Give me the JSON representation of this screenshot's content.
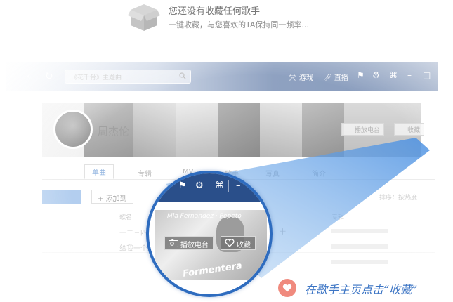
{
  "empty_state": {
    "icon": "open-box-icon",
    "title": "您还没有收藏任何歌手",
    "subtitle": "一键收藏，与您喜欢的TA保持同一频率..."
  },
  "app": {
    "search": {
      "placeholder": "《花千骨》主题曲"
    },
    "header": {
      "game_label": "游戏",
      "live_label": "直播",
      "icons": [
        "shirt-icon",
        "gear-icon",
        "minimize-mode-icon",
        "minimize-icon",
        "close-icon"
      ]
    },
    "artist": {
      "name": "周杰伦",
      "radio_label": "播放电台",
      "fav_label": "收藏"
    },
    "tabs": [
      {
        "label": "单曲"
      },
      {
        "label": "专辑"
      },
      {
        "label": "MV"
      },
      {
        "label": "歌手"
      },
      {
        "label": "写真"
      },
      {
        "label": "简介"
      }
    ],
    "toolbar": {
      "add_to_label": "添加到",
      "sort_label": "排序：按热度"
    },
    "columns": {
      "song": "歌名",
      "album": "专辑"
    },
    "songs": [
      {
        "title": "一二三四五"
      },
      {
        "title": "给我一个理由"
      },
      {
        "title": ""
      }
    ],
    "song_mark": "十"
  },
  "magnifier": {
    "radio_label": "播放电台",
    "fav_label": "收藏",
    "album_logo": "Mia Fernandez · Pepeto",
    "album_word": "Formentera"
  },
  "hint": {
    "text": "在歌手主页点击“收藏”",
    "color": "#3b74c4",
    "badge_color": "#f08a7e"
  },
  "colors": {
    "header_blue": "#2a4f8a",
    "ring_blue": "#2e6cbf"
  }
}
